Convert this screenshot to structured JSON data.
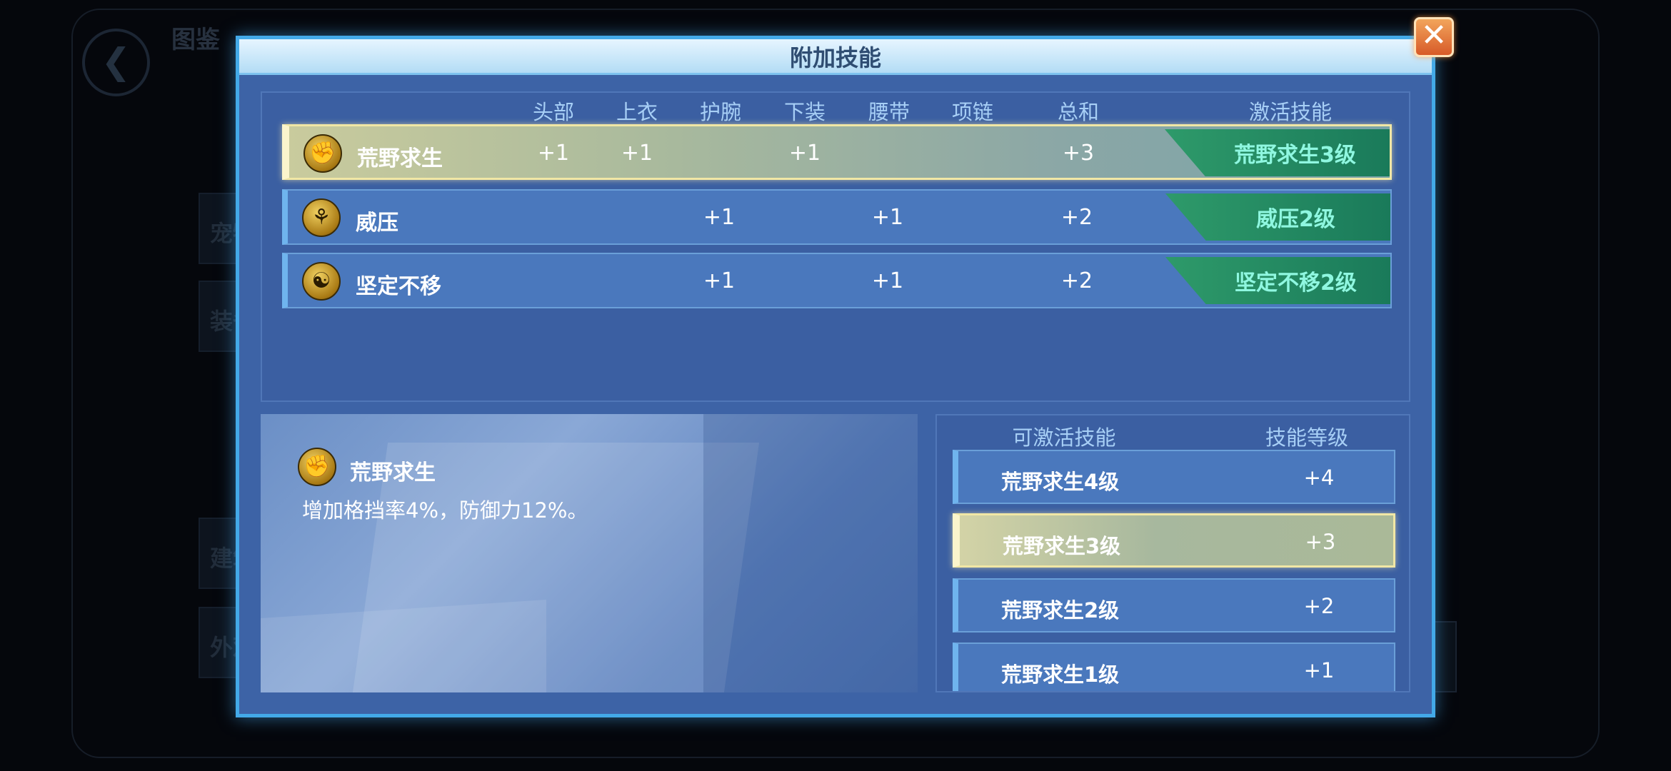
{
  "background": {
    "title": "图鉴",
    "tabs": [
      "宠物",
      "装备",
      "建筑",
      "外观"
    ]
  },
  "dialog": {
    "title": "附加技能",
    "close_icon": "close-icon"
  },
  "table": {
    "headers": {
      "head": "头部",
      "top": "上衣",
      "wrist": "护腕",
      "bottom": "下装",
      "belt": "腰带",
      "necklace": "项链",
      "total": "总和",
      "active": "激活技能"
    },
    "rows": [
      {
        "name": "荒野求生",
        "icon": "fist-skill-icon",
        "head": "+1",
        "top": "+1",
        "wrist": "",
        "bottom": "+1",
        "belt": "",
        "necklace": "",
        "total": "+3",
        "active": "荒野求生3级",
        "selected": true
      },
      {
        "name": "威压",
        "icon": "dragon-skill-icon",
        "head": "",
        "top": "",
        "wrist": "+1",
        "bottom": "",
        "belt": "+1",
        "necklace": "",
        "total": "+2",
        "active": "威压2级",
        "selected": false
      },
      {
        "name": "坚定不移",
        "icon": "meditation-skill-icon",
        "head": "",
        "top": "",
        "wrist": "+1",
        "bottom": "",
        "belt": "+1",
        "necklace": "",
        "total": "+2",
        "active": "坚定不移2级",
        "selected": false
      }
    ]
  },
  "description": {
    "name": "荒野求生",
    "icon": "fist-skill-icon",
    "text": "增加格挡率4%，防御力12%。"
  },
  "activatable": {
    "header_skill": "可激活技能",
    "header_level": "技能等级",
    "items": [
      {
        "name": "荒野求生4级",
        "level": "+4",
        "selected": false
      },
      {
        "name": "荒野求生3级",
        "level": "+3",
        "selected": true
      },
      {
        "name": "荒野求生2级",
        "level": "+2",
        "selected": false
      },
      {
        "name": "荒野求生1级",
        "level": "+1",
        "selected": false
      }
    ]
  },
  "colors": {
    "dialog_bg": "#3d63a6",
    "dialog_border": "#43a9e8",
    "badge_green": "#2e9a6a",
    "badge_text": "#8ff7e0",
    "header_text": "#a7cff6",
    "selected_border": "#f1e7a5"
  }
}
